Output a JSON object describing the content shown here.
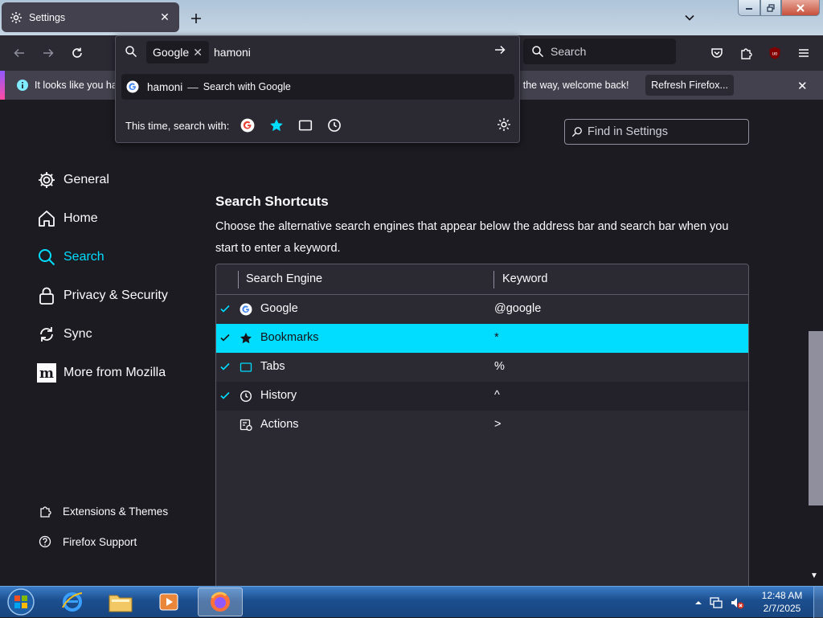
{
  "tab": {
    "title": "Settings"
  },
  "toolbar": {
    "search_placeholder": "Search"
  },
  "urlbar": {
    "engine_chip": "Google",
    "input_value": "hamoni",
    "suggestion_term": "hamoni",
    "suggestion_dash": "—",
    "suggestion_action": "Search with Google",
    "oneoff_label": "This time, search with:"
  },
  "notification": {
    "text_left": "It looks like you ha",
    "text_right": "y the way, welcome back!",
    "button": "Refresh Firefox..."
  },
  "find": {
    "placeholder": "Find in Settings"
  },
  "nav": {
    "items": [
      {
        "label": "General",
        "icon": "gear-icon"
      },
      {
        "label": "Home",
        "icon": "home-icon"
      },
      {
        "label": "Search",
        "icon": "search-icon",
        "selected": true
      },
      {
        "label": "Privacy & Security",
        "icon": "lock-icon"
      },
      {
        "label": "Sync",
        "icon": "sync-icon"
      },
      {
        "label": "More from Mozilla",
        "icon": "mozilla-icon"
      }
    ],
    "footer": [
      {
        "label": "Extensions & Themes",
        "icon": "puzzle-icon"
      },
      {
        "label": "Firefox Support",
        "icon": "help-icon"
      }
    ]
  },
  "section": {
    "title": "Search Shortcuts",
    "description": "Choose the alternative search engines that appear below the address bar and search bar when you start to enter a keyword."
  },
  "table": {
    "headers": {
      "engine": "Search Engine",
      "keyword": "Keyword"
    },
    "rows": [
      {
        "name": "Google",
        "keyword": "@google",
        "checked": true,
        "icon": "google-icon"
      },
      {
        "name": "Bookmarks",
        "keyword": "*",
        "checked": true,
        "icon": "star-icon",
        "selected": true
      },
      {
        "name": "Tabs",
        "keyword": "%",
        "checked": true,
        "icon": "tab-icon"
      },
      {
        "name": "History",
        "keyword": "^",
        "checked": true,
        "icon": "clock-icon"
      },
      {
        "name": "Actions",
        "keyword": ">",
        "checked": false,
        "icon": "actions-icon"
      }
    ]
  },
  "taskbar": {
    "time": "12:48 AM",
    "date": "2/7/2025"
  },
  "colors": {
    "accent": "#00ddff",
    "background": "#1c1b22",
    "surface": "#2b2a33",
    "text": "#fbfbfe"
  }
}
